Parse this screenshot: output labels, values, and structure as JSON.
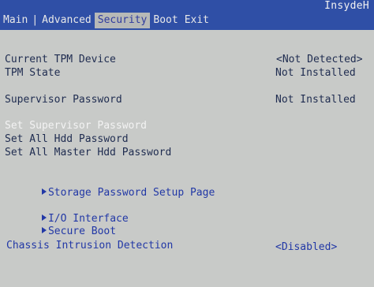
{
  "header": {
    "vendor": "InsydeH",
    "tabs": [
      "Main",
      "Advanced",
      "Security",
      "Boot",
      "Exit"
    ],
    "active_tab": "Security"
  },
  "security": {
    "tpm_device_label": "Current TPM Device",
    "tpm_device_value": "<Not Detected>",
    "tpm_state_label": "TPM State",
    "tpm_state_value": "Not Installed",
    "supervisor_password_label": "Supervisor Password",
    "supervisor_password_value": "Not Installed",
    "set_supervisor_password": "Set Supervisor Password",
    "set_all_hdd_password": "Set All Hdd Password",
    "set_all_master_hdd_password": "Set All Master Hdd Password",
    "storage_password_setup_page": "Storage Password Setup Page",
    "io_interface": "I/O Interface",
    "secure_boot": "Secure Boot",
    "chassis_intrusion_label": "Chassis Intrusion Detection",
    "chassis_intrusion_value": "<Disabled>"
  },
  "colors": {
    "header_bg": "#2f4fa6",
    "body_bg": "#c8cac8",
    "active_tab_bg": "#b7b9b7",
    "highlight_text": "#f3f3f3",
    "selectable_text": "#2238a6",
    "static_text": "#1f2c50"
  },
  "icons": {
    "submenu": "right-triangle-icon"
  }
}
